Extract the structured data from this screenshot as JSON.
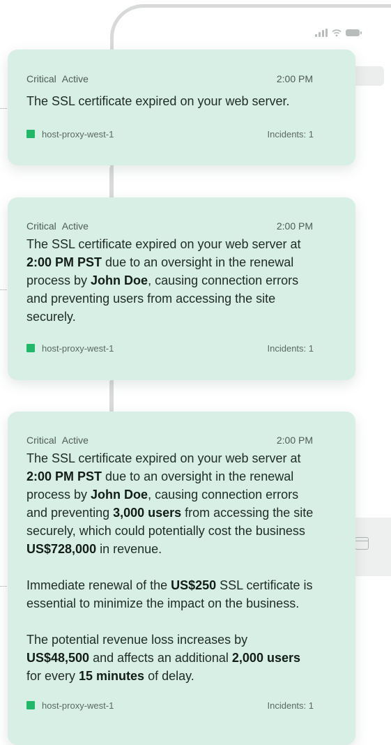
{
  "card1": {
    "severity": "Critical",
    "state": "Active",
    "time": "2:00 PM",
    "message": "The SSL certificate expired on your web server.",
    "host": "host-proxy-west-1",
    "incidents": "Incidents: 1"
  },
  "card2": {
    "severity": "Critical",
    "state": "Active",
    "time": "2:00 PM",
    "t1": "The SSL certificate expired on your web server at ",
    "b1": "2:00 PM PST",
    "t2": " due to an oversight in the renewal process by ",
    "b2": "John Doe",
    "t3": ", causing connection errors and preventing users from accessing the site securely.",
    "host": "host-proxy-west-1",
    "incidents": "Incidents: 1"
  },
  "card3": {
    "severity": "Critical",
    "state": "Active",
    "time": "2:00 PM",
    "p1": {
      "t1": "The SSL certificate expired on your web server at ",
      "b1": "2:00 PM PST",
      "t2": " due to an oversight in the renewal process by ",
      "b2": "John Doe",
      "t3": ", causing connection errors and preventing ",
      "b3": "3,000 users",
      "t4": " from accessing the site securely, which could potentially cost the business ",
      "b4": "US$728,000",
      "t5": " in revenue."
    },
    "p2": {
      "t1": "Immediate renewal of the ",
      "b1": "US$250",
      "t2": " SSL certificate is essential to minimize the impact on the business."
    },
    "p3": {
      "t1": "The potential revenue loss increases by ",
      "b1": "US$48,500",
      "t2": " and affects an additional ",
      "b2": "2,000 users",
      "t3": " for every ",
      "b3": "15 minutes",
      "t4": " of delay."
    },
    "host": "host-proxy-west-1",
    "incidents": "Incidents: 1"
  },
  "colors": {
    "card_bg": "#d8efe5",
    "host_status": "#22b86a",
    "phone_frame": "#d7dad9"
  },
  "icons": [
    "signal-icon",
    "wifi-icon",
    "battery-icon",
    "terminal-icon"
  ]
}
